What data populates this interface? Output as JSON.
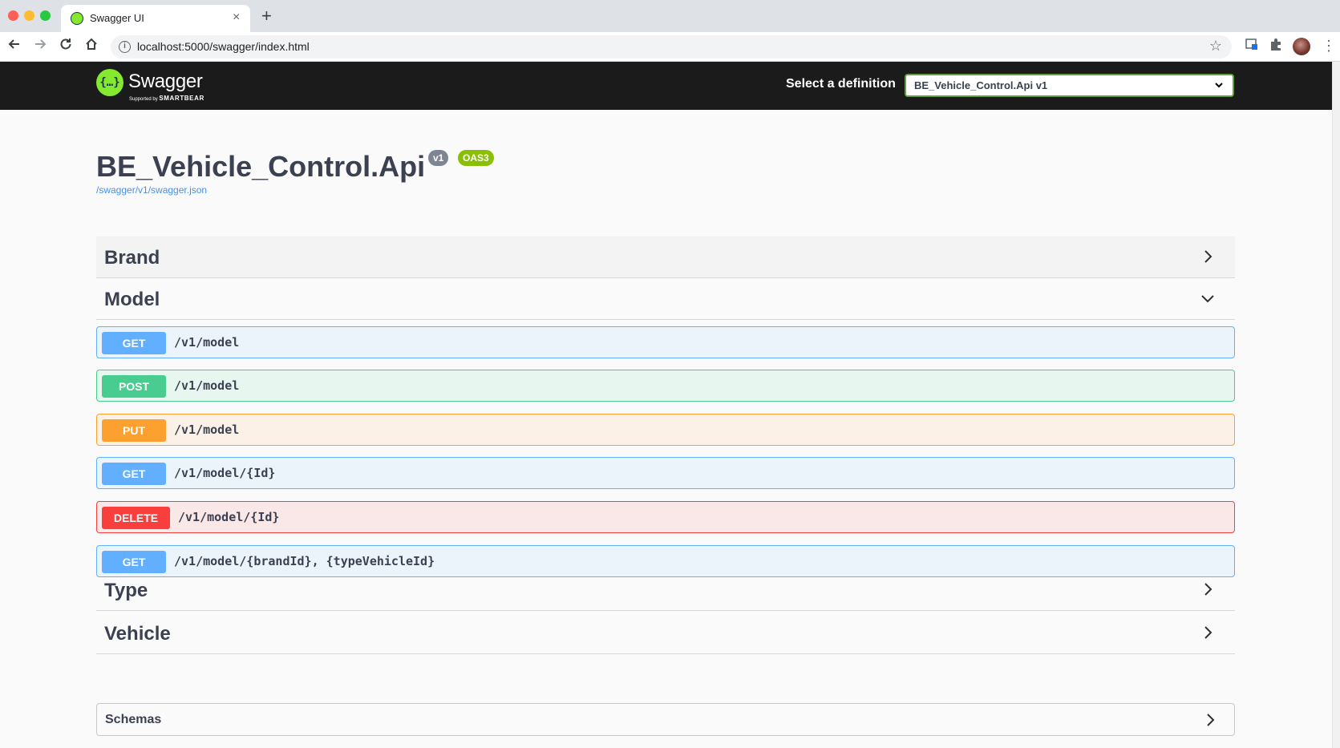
{
  "browser": {
    "tab_title": "Swagger UI",
    "tab_close": "×",
    "new_tab": "+",
    "url": "localhost:5000/swagger/index.html"
  },
  "topbar": {
    "logo_symbol": "{…}",
    "logo_word": "Swagger",
    "logo_sub_prefix": "Supported by ",
    "logo_sub_brand": "SMARTBEAR",
    "select_label": "Select a definition",
    "select_value": "BE_Vehicle_Control.Api v1"
  },
  "info": {
    "title": "BE_Vehicle_Control.Api",
    "version_badge": "v1",
    "oas_badge": "OAS3",
    "spec_link": "/swagger/v1/swagger.json"
  },
  "tags": {
    "brand": "Brand",
    "model": "Model",
    "type": "Type",
    "vehicle": "Vehicle"
  },
  "operations": [
    {
      "method": "GET",
      "path": "/v1/model"
    },
    {
      "method": "POST",
      "path": "/v1/model"
    },
    {
      "method": "PUT",
      "path": "/v1/model"
    },
    {
      "method": "GET",
      "path": "/v1/model/{Id}"
    },
    {
      "method": "DELETE",
      "path": "/v1/model/{Id}"
    },
    {
      "method": "GET",
      "path": "/v1/model/{brandId}, {typeVehicleId}"
    }
  ],
  "schemas": {
    "title": "Schemas"
  },
  "colors": {
    "get": "#61affe",
    "post": "#49cc90",
    "put": "#fca130",
    "delete": "#f93e3e",
    "topbar": "#1b1b1b",
    "swagger_green": "#85ea2d"
  }
}
